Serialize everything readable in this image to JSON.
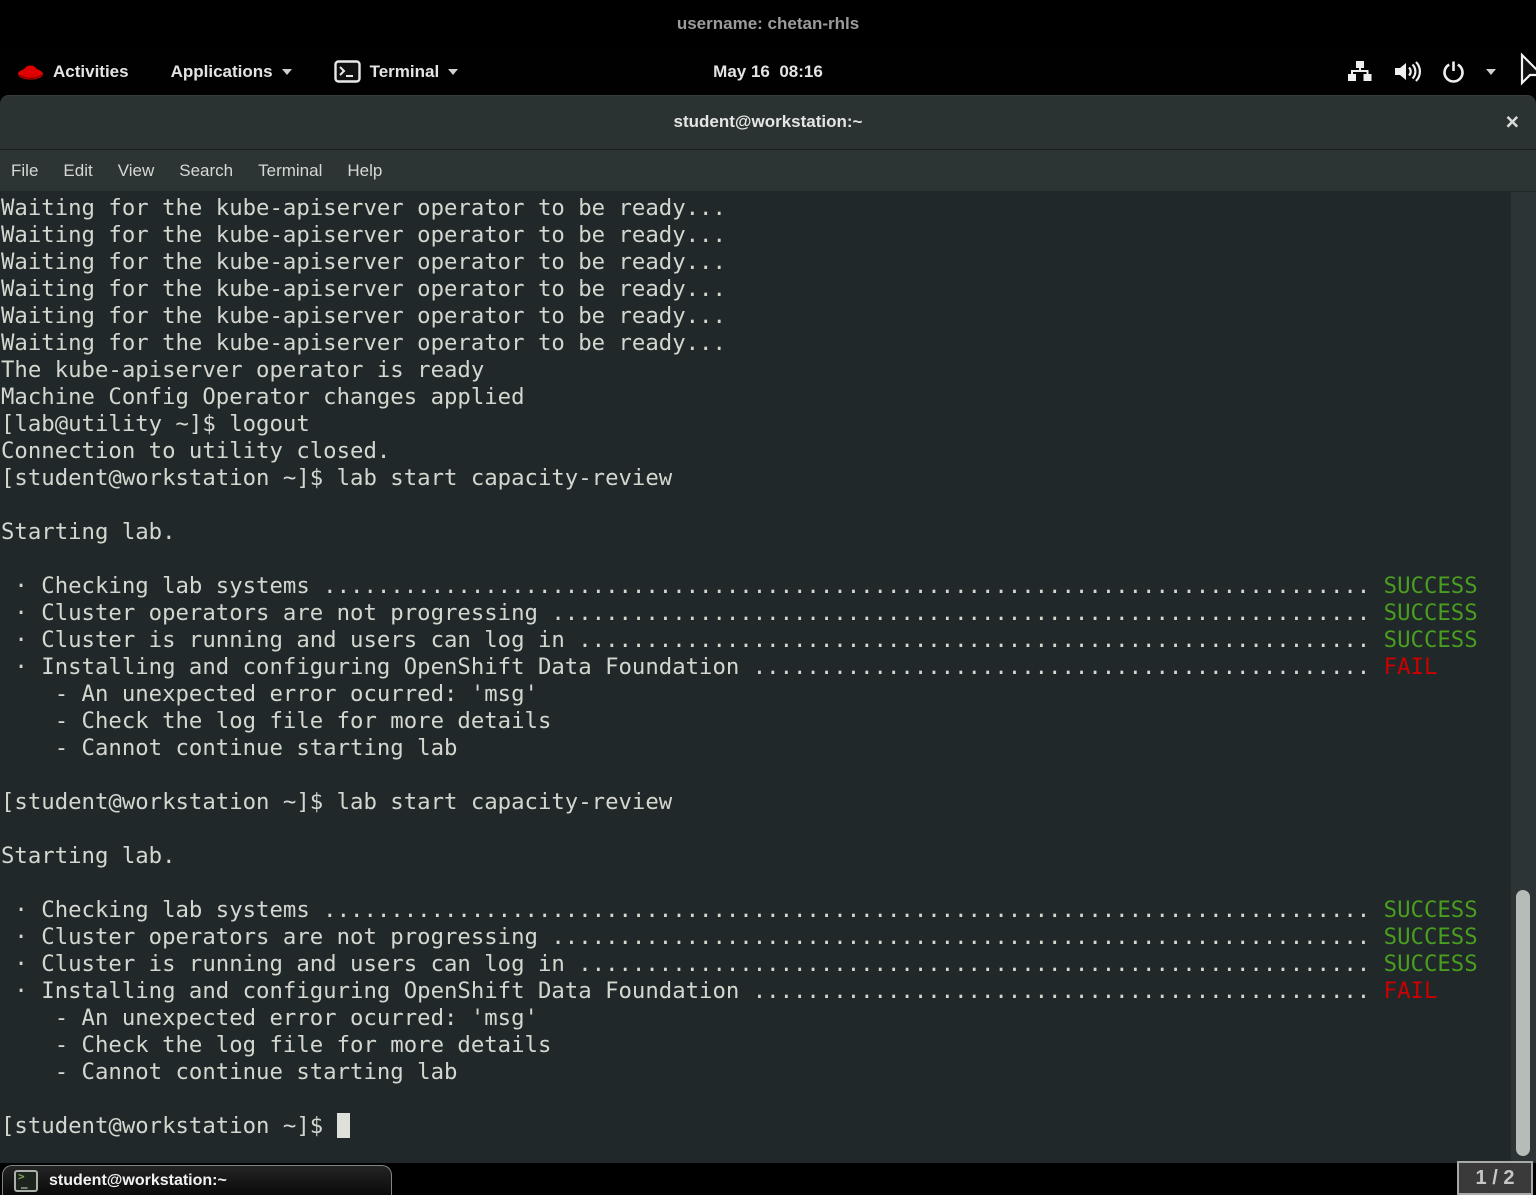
{
  "banner": {
    "username_label": "username: chetan-rhls"
  },
  "topbar": {
    "activities_label": "Activities",
    "applications_label": "Applications",
    "terminal_label": "Terminal",
    "clock": "May 16  08:16"
  },
  "window": {
    "title": "student@workstation:~",
    "close_label": "×",
    "menus": [
      "File",
      "Edit",
      "View",
      "Search",
      "Terminal",
      "Help"
    ]
  },
  "terminal": {
    "fg": "#d3d7cf",
    "bg": "#202829",
    "status_colors": {
      "SUCCESS": "#4a9e20",
      "FAIL": "#cc0000"
    },
    "lines": [
      {
        "text": "Waiting for the kube-apiserver operator to be ready..."
      },
      {
        "text": "Waiting for the kube-apiserver operator to be ready..."
      },
      {
        "text": "Waiting for the kube-apiserver operator to be ready..."
      },
      {
        "text": "Waiting for the kube-apiserver operator to be ready..."
      },
      {
        "text": "Waiting for the kube-apiserver operator to be ready..."
      },
      {
        "text": "Waiting for the kube-apiserver operator to be ready..."
      },
      {
        "text": "The kube-apiserver operator is ready"
      },
      {
        "text": "Machine Config Operator changes applied"
      },
      {
        "text": "[lab@utility ~]$ logout"
      },
      {
        "text": "Connection to utility closed."
      },
      {
        "text": "[student@workstation ~]$ lab start capacity-review"
      },
      {
        "text": ""
      },
      {
        "text": "Starting lab."
      },
      {
        "text": ""
      },
      {
        "label": " · Checking lab systems ",
        "dots": 78,
        "status": "SUCCESS"
      },
      {
        "label": " · Cluster operators are not progressing ",
        "dots": 61,
        "status": "SUCCESS"
      },
      {
        "label": " · Cluster is running and users can log in ",
        "dots": 59,
        "status": "SUCCESS"
      },
      {
        "label": " · Installing and configuring OpenShift Data Foundation ",
        "dots": 46,
        "status": "FAIL"
      },
      {
        "text": "    - An unexpected error ocurred: 'msg'"
      },
      {
        "text": "    - Check the log file for more details"
      },
      {
        "text": "    - Cannot continue starting lab"
      },
      {
        "text": ""
      },
      {
        "text": "[student@workstation ~]$ lab start capacity-review"
      },
      {
        "text": ""
      },
      {
        "text": "Starting lab."
      },
      {
        "text": ""
      },
      {
        "label": " · Checking lab systems ",
        "dots": 78,
        "status": "SUCCESS"
      },
      {
        "label": " · Cluster operators are not progressing ",
        "dots": 61,
        "status": "SUCCESS"
      },
      {
        "label": " · Cluster is running and users can log in ",
        "dots": 59,
        "status": "SUCCESS"
      },
      {
        "label": " · Installing and configuring OpenShift Data Foundation ",
        "dots": 46,
        "status": "FAIL"
      },
      {
        "text": "    - An unexpected error ocurred: 'msg'"
      },
      {
        "text": "    - Check the log file for more details"
      },
      {
        "text": "    - Cannot continue starting lab"
      },
      {
        "text": ""
      },
      {
        "text": "[student@workstation ~]$ ",
        "cursor": true
      }
    ]
  },
  "taskbar": {
    "window_button_label": "student@workstation:~",
    "pager_label": "1 / 2"
  }
}
